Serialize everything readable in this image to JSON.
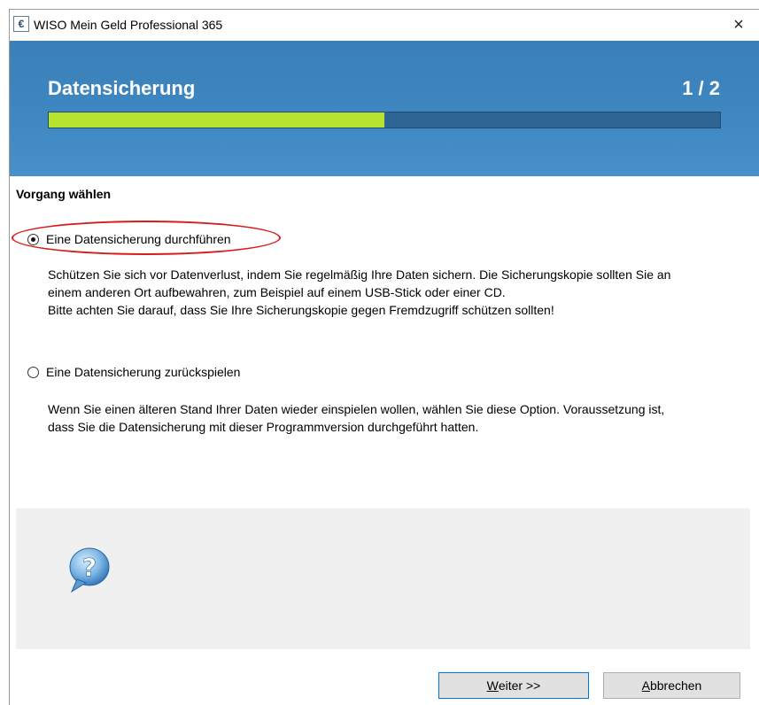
{
  "window": {
    "title": "WISO Mein Geld Professional 365",
    "icon": "euro-icon",
    "icon_glyph": "€",
    "close_glyph": "×"
  },
  "header": {
    "title": "Datensicherung",
    "step": "1 / 2",
    "progress_fraction": 0.5,
    "accent_color": "#3f88c2",
    "progress_color": "#b6e32d"
  },
  "section": {
    "heading": "Vorgang wählen"
  },
  "options": [
    {
      "label": "Eine Datensicherung durchführen",
      "selected": true,
      "description": [
        "Schützen Sie sich vor Datenverlust, indem Sie regelmäßig Ihre Daten sichern. Die Sicherungskopie sollten Sie an",
        "einem anderen Ort aufbewahren, zum Beispiel auf einem USB-Stick oder einer CD.",
        "Bitte achten Sie darauf, dass Sie Ihre Sicherungskopie gegen Fremdzugriff schützen sollten!"
      ]
    },
    {
      "label": "Eine Datensicherung zurückspielen",
      "selected": false,
      "description": [
        "Wenn Sie einen älteren Stand Ihrer Daten wieder einspielen wollen, wählen Sie diese Option. Voraussetzung ist,",
        "dass Sie die Datensicherung mit dieser Programmversion durchgeführt hatten."
      ]
    }
  ],
  "help": {
    "icon": "help-question-icon"
  },
  "buttons": {
    "next_mnemonic": "W",
    "next_rest": "eiter >>",
    "cancel_mnemonic": "A",
    "cancel_rest": "bbrechen"
  },
  "annotation": {
    "highlight_color": "#d81c1c"
  }
}
